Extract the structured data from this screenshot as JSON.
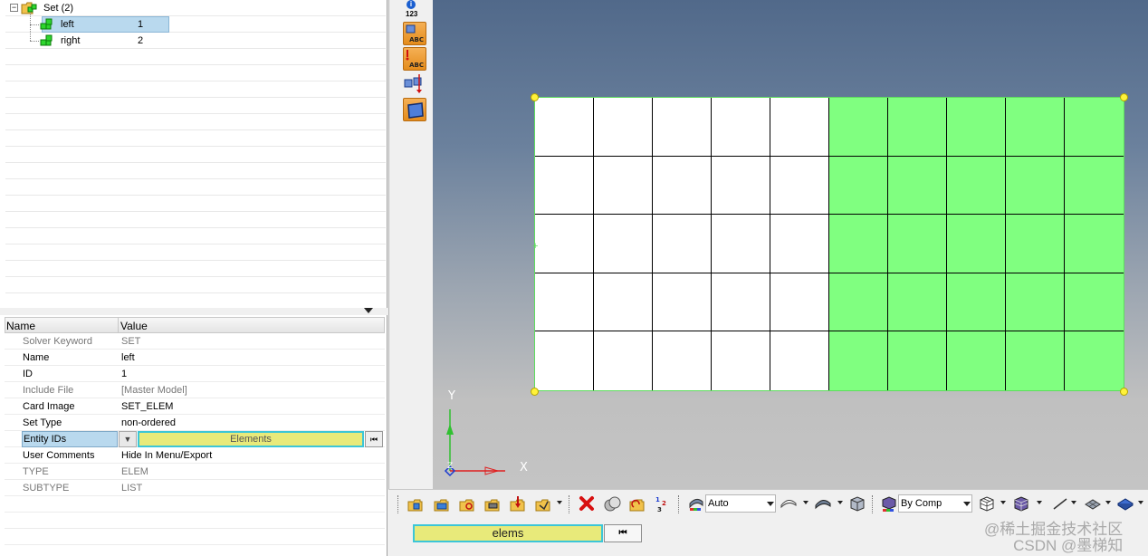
{
  "tree": {
    "root": {
      "label": "Set (2)"
    },
    "children": [
      {
        "label": "left",
        "id": "1",
        "selected": true
      },
      {
        "label": "right",
        "id": "2",
        "selected": false
      }
    ]
  },
  "properties": {
    "header": {
      "name": "Name",
      "value": "Value"
    },
    "rows": [
      {
        "name": "Solver Keyword",
        "value": "SET",
        "dim": true
      },
      {
        "name": "Name",
        "value": "left",
        "dim": false
      },
      {
        "name": "ID",
        "value": "1",
        "dim": false
      },
      {
        "name": "Include File",
        "value": "[Master Model]",
        "dim": true
      },
      {
        "name": "Card Image",
        "value": "SET_ELEM",
        "dim": false
      },
      {
        "name": "Set Type",
        "value": "non-ordered",
        "dim": false
      },
      {
        "name": "Entity IDs",
        "value": "Elements",
        "dim": false
      },
      {
        "name": "User Comments",
        "value": "Hide In Menu/Export",
        "dim": false
      },
      {
        "name": "TYPE",
        "value": "ELEM",
        "dim": true
      },
      {
        "name": "SUBTYPE",
        "value": "LIST",
        "dim": true
      }
    ]
  },
  "icon_bar": {
    "info_number": "123",
    "abc_label": "ABC"
  },
  "viewport": {
    "mesh": {
      "columns": 10,
      "rows": 5,
      "highlighted_columns": [
        5,
        6,
        7,
        8,
        9
      ],
      "highlight_color": "#80ff80",
      "element_color": "#ffffff"
    },
    "axes": {
      "x": "X",
      "y": "Y",
      "z": "Z"
    }
  },
  "bottom_toolbar": {
    "visualization_mode": "Auto",
    "color_mode": "By Comp",
    "selector_value": "elems",
    "reset_glyph": "⏮"
  },
  "watermark": {
    "line1": "@稀土掘金技术社区",
    "line2": "CSDN @墨梯知"
  },
  "colors": {
    "accent_selection": "#3cc6d8",
    "selector_fill": "#e8ea7a",
    "tree_highlight": "#b9d9ee"
  }
}
